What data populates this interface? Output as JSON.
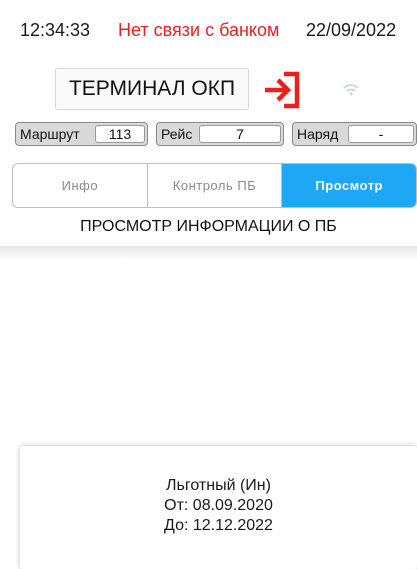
{
  "status": {
    "time": "12:34:33",
    "bank_status": "Нет связи с банком",
    "date": "22/09/2022",
    "bank_status_color": "#e8201f"
  },
  "header": {
    "terminal_label": "ТЕРМИНАЛ ОКП",
    "logout_icon": "logout-icon",
    "signal_icon": "signal-icon",
    "logout_color": "#e8201f"
  },
  "fields": {
    "route": {
      "label": "Маршрут",
      "value": "113"
    },
    "trip": {
      "label": "Рейс",
      "value": "7"
    },
    "order": {
      "label": "Наряд",
      "value": "-"
    }
  },
  "tabs": [
    {
      "label": "Инфо",
      "active": false
    },
    {
      "label": "Контроль ПБ",
      "active": false
    },
    {
      "label": "Просмотр",
      "active": true
    }
  ],
  "accent_color": "#1ea7f4",
  "section_title": "ПРОСМОТР ИНФОРМАЦИИ О ПБ",
  "card": {
    "type": "Льготный (Ин)",
    "from": "От: 08.09.2020",
    "to": "До: 12.12.2022"
  }
}
